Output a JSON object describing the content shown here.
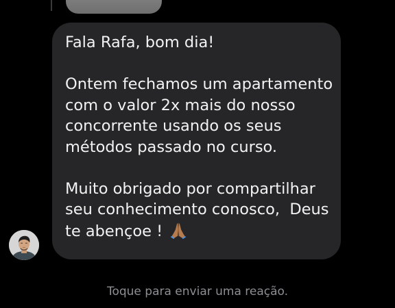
{
  "message": {
    "lines": [
      "Fala Rafa, bom dia!",
      "",
      "Ontem fechamos um apartamento",
      "com o valor 2x mais do nosso",
      "concorrente usando os seus",
      "métodos passado no curso.",
      "",
      "Muito obrigado por compartilhar",
      "seu conhecimento conosco,  Deus",
      "te abençoe ! "
    ],
    "emoji": "pray-emoji"
  },
  "footer": {
    "reaction_hint": "Toque para enviar uma reação."
  },
  "colors": {
    "background": "#000000",
    "bubble": "#262628",
    "text": "#f2f2f2",
    "hint": "#8e8e93"
  }
}
